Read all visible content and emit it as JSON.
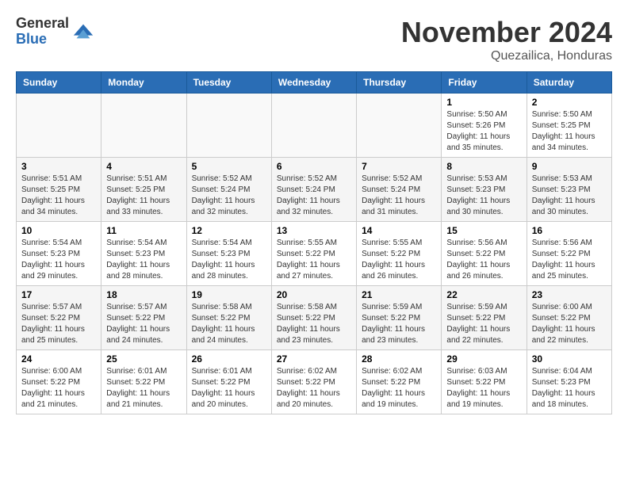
{
  "header": {
    "logo_line1": "General",
    "logo_line2": "Blue",
    "month": "November 2024",
    "location": "Quezailica, Honduras"
  },
  "weekdays": [
    "Sunday",
    "Monday",
    "Tuesday",
    "Wednesday",
    "Thursday",
    "Friday",
    "Saturday"
  ],
  "weeks": [
    [
      {
        "day": "",
        "info": ""
      },
      {
        "day": "",
        "info": ""
      },
      {
        "day": "",
        "info": ""
      },
      {
        "day": "",
        "info": ""
      },
      {
        "day": "",
        "info": ""
      },
      {
        "day": "1",
        "info": "Sunrise: 5:50 AM\nSunset: 5:26 PM\nDaylight: 11 hours and 35 minutes."
      },
      {
        "day": "2",
        "info": "Sunrise: 5:50 AM\nSunset: 5:25 PM\nDaylight: 11 hours and 34 minutes."
      }
    ],
    [
      {
        "day": "3",
        "info": "Sunrise: 5:51 AM\nSunset: 5:25 PM\nDaylight: 11 hours and 34 minutes."
      },
      {
        "day": "4",
        "info": "Sunrise: 5:51 AM\nSunset: 5:25 PM\nDaylight: 11 hours and 33 minutes."
      },
      {
        "day": "5",
        "info": "Sunrise: 5:52 AM\nSunset: 5:24 PM\nDaylight: 11 hours and 32 minutes."
      },
      {
        "day": "6",
        "info": "Sunrise: 5:52 AM\nSunset: 5:24 PM\nDaylight: 11 hours and 32 minutes."
      },
      {
        "day": "7",
        "info": "Sunrise: 5:52 AM\nSunset: 5:24 PM\nDaylight: 11 hours and 31 minutes."
      },
      {
        "day": "8",
        "info": "Sunrise: 5:53 AM\nSunset: 5:23 PM\nDaylight: 11 hours and 30 minutes."
      },
      {
        "day": "9",
        "info": "Sunrise: 5:53 AM\nSunset: 5:23 PM\nDaylight: 11 hours and 30 minutes."
      }
    ],
    [
      {
        "day": "10",
        "info": "Sunrise: 5:54 AM\nSunset: 5:23 PM\nDaylight: 11 hours and 29 minutes."
      },
      {
        "day": "11",
        "info": "Sunrise: 5:54 AM\nSunset: 5:23 PM\nDaylight: 11 hours and 28 minutes."
      },
      {
        "day": "12",
        "info": "Sunrise: 5:54 AM\nSunset: 5:23 PM\nDaylight: 11 hours and 28 minutes."
      },
      {
        "day": "13",
        "info": "Sunrise: 5:55 AM\nSunset: 5:22 PM\nDaylight: 11 hours and 27 minutes."
      },
      {
        "day": "14",
        "info": "Sunrise: 5:55 AM\nSunset: 5:22 PM\nDaylight: 11 hours and 26 minutes."
      },
      {
        "day": "15",
        "info": "Sunrise: 5:56 AM\nSunset: 5:22 PM\nDaylight: 11 hours and 26 minutes."
      },
      {
        "day": "16",
        "info": "Sunrise: 5:56 AM\nSunset: 5:22 PM\nDaylight: 11 hours and 25 minutes."
      }
    ],
    [
      {
        "day": "17",
        "info": "Sunrise: 5:57 AM\nSunset: 5:22 PM\nDaylight: 11 hours and 25 minutes."
      },
      {
        "day": "18",
        "info": "Sunrise: 5:57 AM\nSunset: 5:22 PM\nDaylight: 11 hours and 24 minutes."
      },
      {
        "day": "19",
        "info": "Sunrise: 5:58 AM\nSunset: 5:22 PM\nDaylight: 11 hours and 24 minutes."
      },
      {
        "day": "20",
        "info": "Sunrise: 5:58 AM\nSunset: 5:22 PM\nDaylight: 11 hours and 23 minutes."
      },
      {
        "day": "21",
        "info": "Sunrise: 5:59 AM\nSunset: 5:22 PM\nDaylight: 11 hours and 23 minutes."
      },
      {
        "day": "22",
        "info": "Sunrise: 5:59 AM\nSunset: 5:22 PM\nDaylight: 11 hours and 22 minutes."
      },
      {
        "day": "23",
        "info": "Sunrise: 6:00 AM\nSunset: 5:22 PM\nDaylight: 11 hours and 22 minutes."
      }
    ],
    [
      {
        "day": "24",
        "info": "Sunrise: 6:00 AM\nSunset: 5:22 PM\nDaylight: 11 hours and 21 minutes."
      },
      {
        "day": "25",
        "info": "Sunrise: 6:01 AM\nSunset: 5:22 PM\nDaylight: 11 hours and 21 minutes."
      },
      {
        "day": "26",
        "info": "Sunrise: 6:01 AM\nSunset: 5:22 PM\nDaylight: 11 hours and 20 minutes."
      },
      {
        "day": "27",
        "info": "Sunrise: 6:02 AM\nSunset: 5:22 PM\nDaylight: 11 hours and 20 minutes."
      },
      {
        "day": "28",
        "info": "Sunrise: 6:02 AM\nSunset: 5:22 PM\nDaylight: 11 hours and 19 minutes."
      },
      {
        "day": "29",
        "info": "Sunrise: 6:03 AM\nSunset: 5:22 PM\nDaylight: 11 hours and 19 minutes."
      },
      {
        "day": "30",
        "info": "Sunrise: 6:04 AM\nSunset: 5:23 PM\nDaylight: 11 hours and 18 minutes."
      }
    ]
  ]
}
